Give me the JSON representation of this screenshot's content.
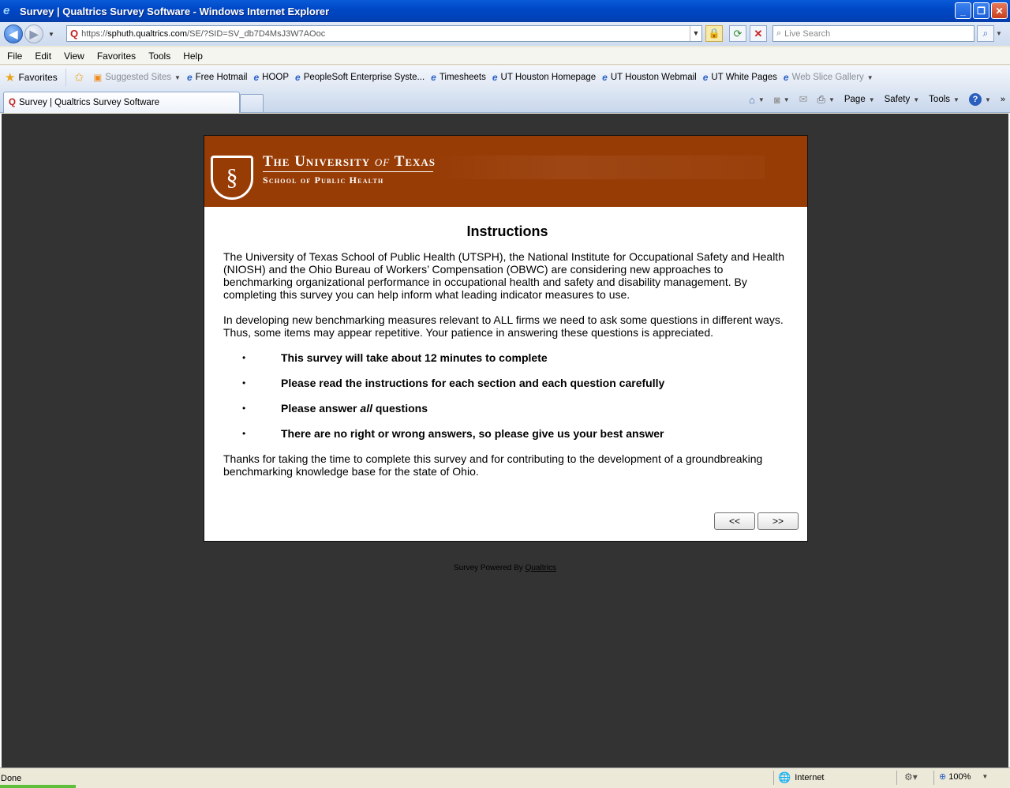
{
  "window": {
    "title": "Survey | Qualtrics Survey Software - Windows Internet Explorer",
    "minimize": "_",
    "restore": "❐",
    "close": "✕"
  },
  "address_bar": {
    "url_prefix": "https://",
    "url_host": "sphuth.qualtrics.com",
    "url_path": "/SE/?SID=SV_db7D4MsJ3W7AOoc",
    "search_placeholder": "Live Search"
  },
  "menu": [
    "File",
    "Edit",
    "View",
    "Favorites",
    "Tools",
    "Help"
  ],
  "favorites_bar": {
    "favorites_label": "Favorites",
    "items": [
      {
        "label": "Suggested Sites",
        "dim": true
      },
      {
        "label": "Free Hotmail"
      },
      {
        "label": "HOOP"
      },
      {
        "label": "PeopleSoft Enterprise Syste..."
      },
      {
        "label": "Timesheets"
      },
      {
        "label": "UT Houston Homepage"
      },
      {
        "label": "UT Houston Webmail"
      },
      {
        "label": "UT White Pages"
      },
      {
        "label": "Web Slice Gallery",
        "dim": true
      }
    ]
  },
  "tabs": [
    {
      "label": "Survey | Qualtrics Survey Software",
      "active": true
    }
  ],
  "command_bar": {
    "page": "Page",
    "safety": "Safety",
    "tools": "Tools",
    "help": "?"
  },
  "survey": {
    "banner": {
      "university_a": "The University",
      "university_of": "of",
      "university_b": "Texas",
      "school": "School of Public Health"
    },
    "heading": "Instructions",
    "paragraph1": "The University of Texas School of Public Health (UTSPH), the National Institute for Occupational Safety and Health (NIOSH) and the Ohio Bureau of Workers’ Compensation (OBWC) are considering new approaches to benchmarking organizational performance in occupational health and safety and disability management. By completing this survey you can help inform what leading indicator measures to use.",
    "paragraph2": "In developing new benchmarking measures relevant to ALL firms we need to ask some questions in different ways. Thus, some items may appear repetitive. Your patience in answering these questions is appreciated.",
    "bullets": {
      "b1": "This survey will take about 12 minutes to complete",
      "b2": "Please read the instructions for each section and each question carefully",
      "b3_pre": "Please answer ",
      "b3_em": "all",
      "b3_post": " questions",
      "b4": "There are no right or wrong answers, so please give us your best answer"
    },
    "paragraph3": "Thanks for taking the time to complete this survey and for contributing to the development of a groundbreaking benchmarking knowledge base for the state of Ohio.",
    "back_button": "<<",
    "next_button": ">>"
  },
  "footer": {
    "powered_by": "Survey Powered By ",
    "link": "Qualtrics"
  },
  "status_bar": {
    "status": "Done",
    "zone": "Internet",
    "zoom": "100%"
  }
}
